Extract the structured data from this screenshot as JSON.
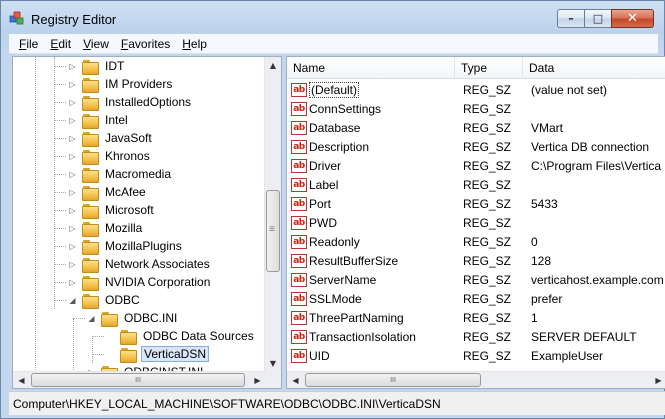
{
  "window": {
    "title": "Registry Editor",
    "icon": "registry-editor-icon"
  },
  "caption_buttons": {
    "minimize": "–",
    "maximize": "□",
    "close": "✕"
  },
  "menu": [
    {
      "label": "File",
      "underline": "F",
      "rest": "ile"
    },
    {
      "label": "Edit",
      "underline": "E",
      "rest": "dit"
    },
    {
      "label": "View",
      "underline": "V",
      "rest": "iew"
    },
    {
      "label": "Favorites",
      "underline": "F",
      "rest": "avorites"
    },
    {
      "label": "Help",
      "underline": "H",
      "rest": "elp"
    }
  ],
  "tree": {
    "items": [
      {
        "label": "IDT",
        "level": 0,
        "expander": "▷"
      },
      {
        "label": "IM Providers",
        "level": 0,
        "expander": "▷"
      },
      {
        "label": "InstalledOptions",
        "level": 0,
        "expander": "▷"
      },
      {
        "label": "Intel",
        "level": 0,
        "expander": "▷"
      },
      {
        "label": "JavaSoft",
        "level": 0,
        "expander": "▷"
      },
      {
        "label": "Khronos",
        "level": 0,
        "expander": "▷"
      },
      {
        "label": "Macromedia",
        "level": 0,
        "expander": "▷"
      },
      {
        "label": "McAfee",
        "level": 0,
        "expander": "▷"
      },
      {
        "label": "Microsoft",
        "level": 0,
        "expander": "▷"
      },
      {
        "label": "Mozilla",
        "level": 0,
        "expander": "▷"
      },
      {
        "label": "MozillaPlugins",
        "level": 0,
        "expander": "▷"
      },
      {
        "label": "Network Associates",
        "level": 0,
        "expander": "▷"
      },
      {
        "label": "NVIDIA Corporation",
        "level": 0,
        "expander": "▷"
      },
      {
        "label": "ODBC",
        "level": 0,
        "expander": "◢"
      },
      {
        "label": "ODBC.INI",
        "level": 1,
        "expander": "◢"
      },
      {
        "label": "ODBC Data Sources",
        "level": 2,
        "expander": ""
      },
      {
        "label": "VerticaDSN",
        "level": 2,
        "expander": "",
        "selected": true
      },
      {
        "label": "ODBCINST.INI",
        "level": 1,
        "expander": "▷"
      }
    ],
    "scroll_up": "▲",
    "scroll_down": "▼",
    "scroll_left": "◀",
    "scroll_right": "▶",
    "thumb_grip": "≡",
    "hthumb_grip": "III"
  },
  "values": {
    "columns": {
      "name": "Name",
      "type": "Type",
      "data": "Data"
    },
    "icon_text": "ab",
    "rows": [
      {
        "name": "(Default)",
        "type": "REG_SZ",
        "data": "(value not set)",
        "is_default": true
      },
      {
        "name": "ConnSettings",
        "type": "REG_SZ",
        "data": ""
      },
      {
        "name": "Database",
        "type": "REG_SZ",
        "data": "VMart"
      },
      {
        "name": "Description",
        "type": "REG_SZ",
        "data": "Vertica DB connection"
      },
      {
        "name": "Driver",
        "type": "REG_SZ",
        "data": "C:\\Program Files\\Vertica"
      },
      {
        "name": "Label",
        "type": "REG_SZ",
        "data": ""
      },
      {
        "name": "Port",
        "type": "REG_SZ",
        "data": "5433"
      },
      {
        "name": "PWD",
        "type": "REG_SZ",
        "data": ""
      },
      {
        "name": "Readonly",
        "type": "REG_SZ",
        "data": "0"
      },
      {
        "name": "ResultBufferSize",
        "type": "REG_SZ",
        "data": "128"
      },
      {
        "name": "ServerName",
        "type": "REG_SZ",
        "data": "verticahost.example.com"
      },
      {
        "name": "SSLMode",
        "type": "REG_SZ",
        "data": "prefer"
      },
      {
        "name": "ThreePartNaming",
        "type": "REG_SZ",
        "data": "1"
      },
      {
        "name": "TransactionIsolation",
        "type": "REG_SZ",
        "data": "SERVER DEFAULT"
      },
      {
        "name": "UID",
        "type": "REG_SZ",
        "data": "ExampleUser"
      }
    ]
  },
  "status_bar": {
    "path": "Computer\\HKEY_LOCAL_MACHINE\\SOFTWARE\\ODBC\\ODBC.INI\\VerticaDSN"
  },
  "colors": {
    "title_bg": "#c4d7ee",
    "selection": "#d8e6f7",
    "close_button": "#c24a2c",
    "value_icon": "#cc2211"
  }
}
